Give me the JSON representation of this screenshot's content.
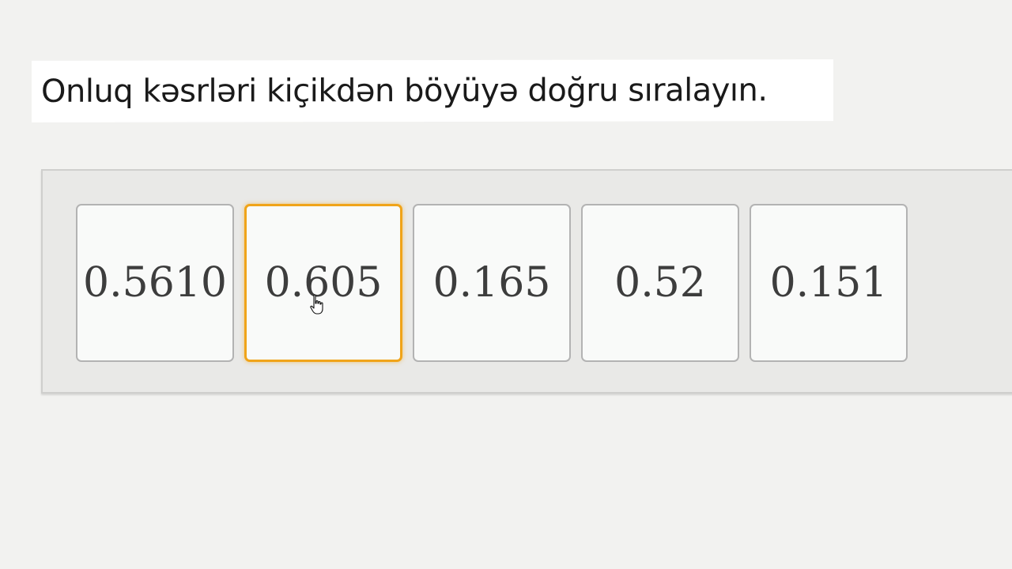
{
  "prompt": {
    "text": "Onluq kəsrləri kiçikdən böyüyə doğru sıralayın."
  },
  "cards": [
    {
      "value": "0.5610",
      "selected": false
    },
    {
      "value": "0.605",
      "selected": true
    },
    {
      "value": "0.165",
      "selected": false
    },
    {
      "value": "0.52",
      "selected": false
    },
    {
      "value": "0.151",
      "selected": false
    }
  ],
  "colors": {
    "selected_border": "#f0a419",
    "background": "#f2f2f0",
    "card_border": "#b3b3b3"
  },
  "icons": {
    "cursor": "hand-pointer-icon"
  }
}
